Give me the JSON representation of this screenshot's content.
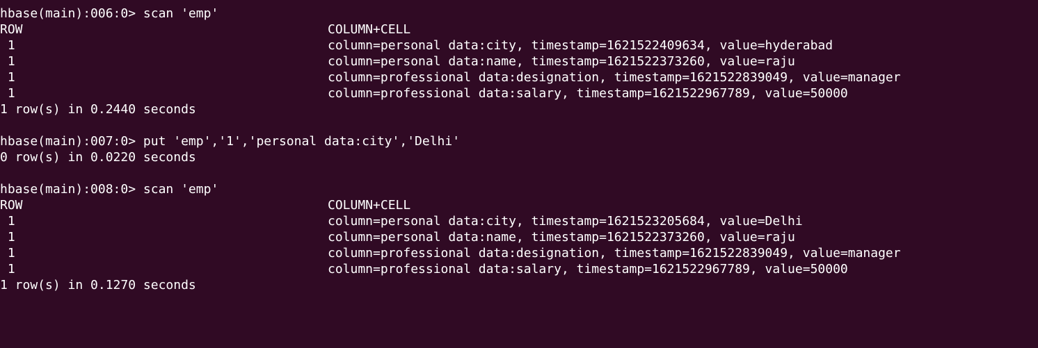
{
  "terminal": {
    "background": "#300a24",
    "foreground": "#ffffff",
    "blocks": [
      {
        "prompt": "hbase(main):006:0> scan 'emp'",
        "header": {
          "row": "ROW",
          "cell": "COLUMN+CELL"
        },
        "rows": [
          {
            "key": " 1",
            "cell": "column=personal data:city, timestamp=1621522409634, value=hyderabad"
          },
          {
            "key": " 1",
            "cell": "column=personal data:name, timestamp=1621522373260, value=raju"
          },
          {
            "key": " 1",
            "cell": "column=professional data:designation, timestamp=1621522839049, value=manager"
          },
          {
            "key": " 1",
            "cell": "column=professional data:salary, timestamp=1621522967789, value=50000"
          }
        ],
        "summary": "1 row(s) in 0.2440 seconds"
      },
      {
        "prompt": "hbase(main):007:0> put 'emp','1','personal data:city','Delhi'",
        "summary": "0 row(s) in 0.0220 seconds"
      },
      {
        "prompt": "hbase(main):008:0> scan 'emp'",
        "header": {
          "row": "ROW",
          "cell": "COLUMN+CELL"
        },
        "rows": [
          {
            "key": " 1",
            "cell": "column=personal data:city, timestamp=1621523205684, value=Delhi"
          },
          {
            "key": " 1",
            "cell": "column=personal data:name, timestamp=1621522373260, value=raju"
          },
          {
            "key": " 1",
            "cell": "column=professional data:designation, timestamp=1621522839049, value=manager"
          },
          {
            "key": " 1",
            "cell": "column=professional data:salary, timestamp=1621522967789, value=50000"
          }
        ],
        "summary": "1 row(s) in 0.1270 seconds"
      }
    ]
  }
}
